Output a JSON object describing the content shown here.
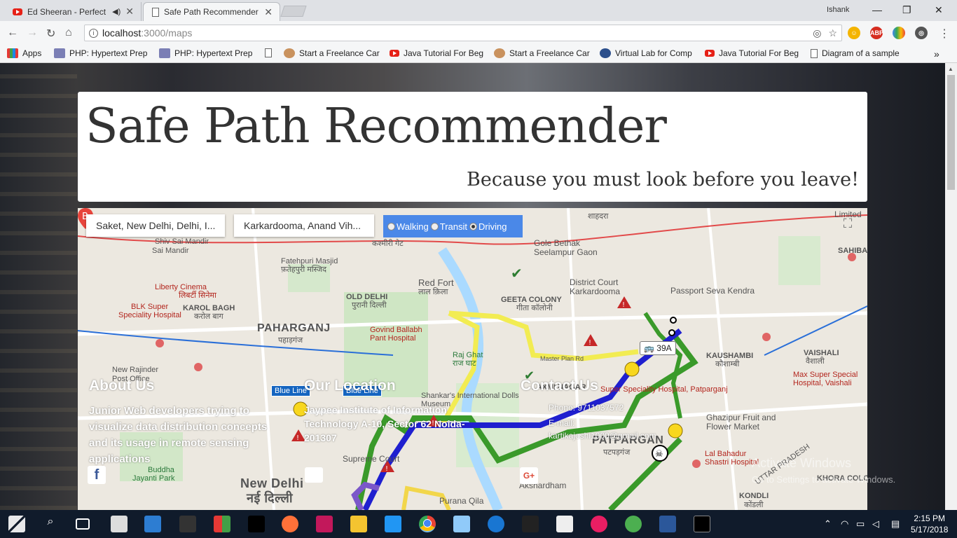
{
  "browser": {
    "tabs": [
      {
        "title": "Ed Sheeran - Perfect (",
        "icon": "youtube-icon",
        "active": false
      },
      {
        "title": "Safe Path Recommender",
        "icon": "page-icon",
        "active": true
      }
    ],
    "user": "Ishank",
    "url_host": "localhost",
    "url_path": ":3000/maps",
    "bookmarks": [
      {
        "label": "Apps",
        "icon": "apps-grid-icon"
      },
      {
        "label": "PHP: Hypertext Prep",
        "icon": "php-icon"
      },
      {
        "label": "PHP: Hypertext Prep",
        "icon": "php-icon"
      },
      {
        "label": "",
        "icon": "page-icon"
      },
      {
        "label": "Start a Freelance Car",
        "icon": "avatar-icon"
      },
      {
        "label": "Java Tutorial For Beg",
        "icon": "youtube-icon"
      },
      {
        "label": "Start a Freelance Car",
        "icon": "avatar-icon"
      },
      {
        "label": "Virtual Lab for Comp",
        "icon": "lab-icon"
      },
      {
        "label": "Java Tutorial For Beg",
        "icon": "youtube-icon"
      },
      {
        "label": "Diagram of a sample",
        "icon": "page-icon"
      }
    ],
    "more": "»"
  },
  "header": {
    "title": "Safe Path Recommender",
    "tagline": "Because you must look before you leave!"
  },
  "map": {
    "origin": "Saket, New Delhi, Delhi, I...",
    "destination": "Karkardooma, Anand Vih...",
    "modes": [
      "Walking",
      "Transit",
      "Driving"
    ],
    "selected_mode": "Driving",
    "bus_route": "39A",
    "marker_label": "B",
    "metro_badges": [
      "Blue Line",
      "Blue Line"
    ],
    "labels": {
      "shiv_sai_1": "Shiv Sai Mandir",
      "shiv_sai_2": "Sai Mandir",
      "fatehpuri": "Fatehpuri Masjid",
      "fatehpuri_hi": "फ़तेहपुरी मस्जिद",
      "liberty": "Liberty Cinema",
      "liberty_hi": "लिबर्टी सिनेमा",
      "blk1": "BLK Super",
      "blk2": "Speciality Hospital",
      "karol": "KAROL BAGH",
      "karol_hi": "करोल बाग",
      "paharganj": "PAHARGANJ",
      "paharganj_hi": "पहाड़गंज",
      "old_delhi": "OLD DELHI",
      "old_delhi_hi": "पुरानी दिल्ली",
      "red_fort": "Red Fort",
      "red_fort_hi": "लाल क़िला",
      "govind1": "Govind Ballabh",
      "govind2": "Pant Hospital",
      "raj_ghat": "Raj Ghat",
      "raj_ghat_hi": "राज घाट",
      "geeta": "GEETA COLONY",
      "geeta_hi": "गीता कॉलोनी",
      "gole1": "Gole Bethak",
      "gole2": "Seelampur Gaon",
      "district1": "District Court",
      "district2": "Karkardooma",
      "passport": "Passport Seva Kendra",
      "sahibabad": "SAHIBABA",
      "kaushambi": "KAUSHAMBI",
      "kaushambi_hi": "कौशाम्बी",
      "vaishali": "VAISHALI",
      "vaishali_hi": "वैशाली",
      "max1": "Max Super Special",
      "max2": "Hospital, Vaishali",
      "ghazipur1": "Ghazipur Fruit and",
      "ghazipur2": "Flower Market",
      "lal1": "Lal Bahadur",
      "lal2": "Shastri Hospital",
      "patpargan": "PATPARGAN",
      "patpargan_hi": "पटपड़गंज",
      "khora": "KHORA COLONY",
      "kondli": "KONDLI",
      "kondli_hi": "कोंडली",
      "new_delhi": "New Delhi",
      "new_delhi_hi": "नई दिल्ली",
      "supreme": "Supreme Court",
      "akshardham": "Akshardham",
      "purana": "Purana Qila",
      "buddha1": "Buddha",
      "buddha2": "Jayanti Park",
      "new_rajinder1": "New Rajinder",
      "new_rajinder2": "Post Office",
      "limited": "Limited",
      "uttar": "UTTAR PRADESH",
      "master_plan": "Master Plan Rd",
      "shahdara": "शाहदरा",
      "kashmiri": "कश्मीरी गेट",
      "laxmi": "LAXMI NAGAR",
      "max_patpar": "Super Speciality Hospital, Patparganj",
      "dolls": "Shankar's International Dolls Museum"
    }
  },
  "footer": {
    "about_title": "About Us",
    "about_text": "Junior Web developers trying to visualize data distribution concepts and its usage in remote sensing applications",
    "location_title": "Our Location",
    "location_text": "Jaypee Institute of Information Technology A-10, Sector 62 Noida-201307",
    "contact_title": "Contact Us",
    "phone": "Phone: 9711037572",
    "email_label": "E-mail:",
    "email": "kartikajoshi1000@gmail.com"
  },
  "windows": {
    "watermark1": "Activate Windows",
    "watermark2": "Go to Settings to activate Windows.",
    "time": "2:15 PM",
    "date": "5/17/2018"
  },
  "route_colors": {
    "safe": "#3a9a2a",
    "moderate": "#f0e24a",
    "transit": "#1f1fcf",
    "walk_purple": "#7b57c9"
  }
}
